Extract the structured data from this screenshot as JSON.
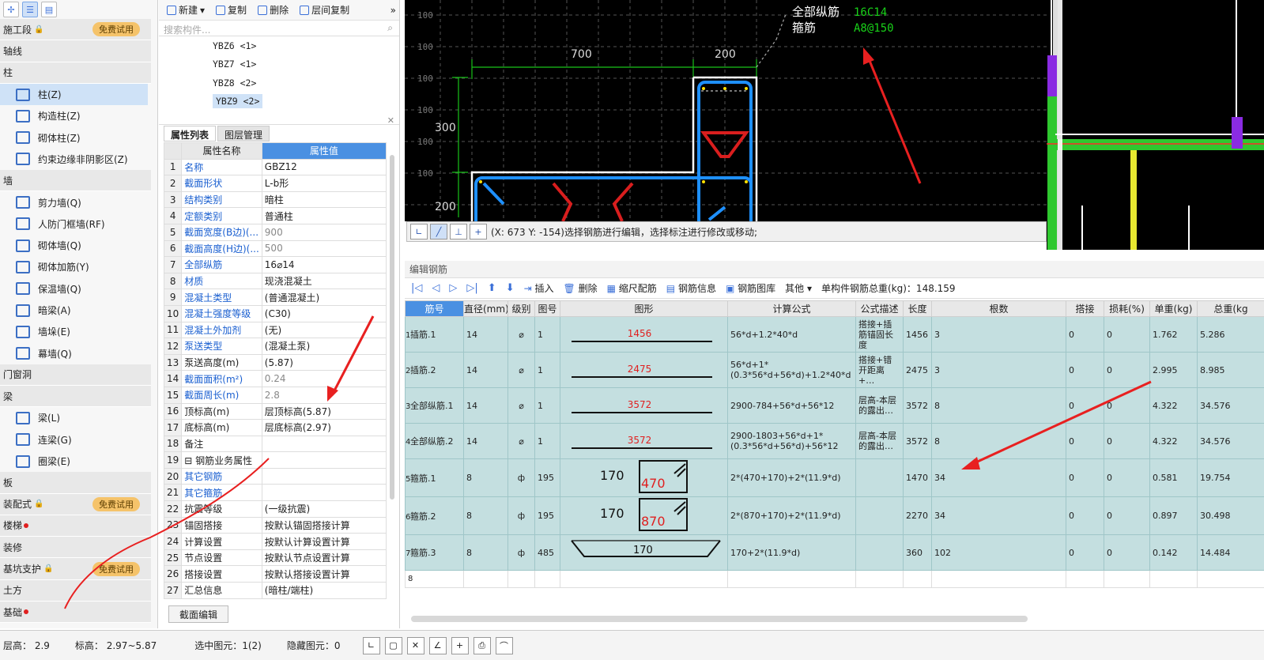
{
  "nav": {
    "rows": [
      {
        "type": "cat",
        "label": "施工段",
        "lock": true,
        "badge": "免费试用"
      },
      {
        "type": "cat",
        "label": "轴线"
      },
      {
        "type": "cat",
        "label": "柱"
      },
      {
        "type": "item",
        "label": "柱(Z)",
        "sel": true
      },
      {
        "type": "item",
        "label": "构造柱(Z)"
      },
      {
        "type": "item",
        "label": "砌体柱(Z)"
      },
      {
        "type": "item",
        "label": "约束边缘非阴影区(Z)"
      },
      {
        "type": "cat",
        "label": "墙"
      },
      {
        "type": "item",
        "label": "剪力墙(Q)"
      },
      {
        "type": "item",
        "label": "人防门框墙(RF)"
      },
      {
        "type": "item",
        "label": "砌体墙(Q)"
      },
      {
        "type": "item",
        "label": "砌体加筋(Y)"
      },
      {
        "type": "item",
        "label": "保温墙(Q)"
      },
      {
        "type": "item",
        "label": "暗梁(A)"
      },
      {
        "type": "item",
        "label": "墙垛(E)"
      },
      {
        "type": "item",
        "label": "幕墙(Q)"
      },
      {
        "type": "cat",
        "label": "门窗洞"
      },
      {
        "type": "cat",
        "label": "梁"
      },
      {
        "type": "item",
        "label": "梁(L)"
      },
      {
        "type": "item",
        "label": "连梁(G)"
      },
      {
        "type": "item",
        "label": "圈梁(E)"
      },
      {
        "type": "cat",
        "label": "板"
      },
      {
        "type": "cat",
        "label": "装配式",
        "lock": true,
        "badge": "免费试用"
      },
      {
        "type": "cat",
        "label": "楼梯",
        "dot": true
      },
      {
        "type": "cat",
        "label": "装修"
      },
      {
        "type": "cat",
        "label": "基坑支护",
        "lock": true,
        "badge": "免费试用"
      },
      {
        "type": "cat",
        "label": "土方"
      },
      {
        "type": "cat",
        "label": "基础",
        "dot": true
      }
    ]
  },
  "mid": {
    "toolbar": {
      "new": "新建",
      "copy": "复制",
      "delete": "删除",
      "floor_copy": "层间复制"
    },
    "search_placeholder": "搜索构件...",
    "components": [
      "YBZ6 <1>",
      "YBZ7 <1>",
      "YBZ8 <2>",
      "YBZ9 <2>"
    ],
    "tabs": [
      "属性列表",
      "图层管理"
    ],
    "prop_header": [
      "属性名称",
      "属性值"
    ],
    "props": [
      {
        "n": "1",
        "k": "名称",
        "v": "GBZ12",
        "kb": true
      },
      {
        "n": "2",
        "k": "截面形状",
        "v": "L-b形",
        "kb": true
      },
      {
        "n": "3",
        "k": "结构类别",
        "v": "暗柱",
        "kb": true
      },
      {
        "n": "4",
        "k": "定额类别",
        "v": "普通柱",
        "kb": true
      },
      {
        "n": "5",
        "k": "截面宽度(B边)(...",
        "v": "900",
        "kb": true,
        "vg": true
      },
      {
        "n": "6",
        "k": "截面高度(H边)(...",
        "v": "500",
        "kb": true,
        "vg": true
      },
      {
        "n": "7",
        "k": "全部纵筋",
        "v": "16⌀14",
        "kb": true
      },
      {
        "n": "8",
        "k": "材质",
        "v": "现浇混凝土",
        "kb": true
      },
      {
        "n": "9",
        "k": "混凝土类型",
        "v": "(普通混凝土)",
        "kb": true
      },
      {
        "n": "10",
        "k": "混凝土强度等级",
        "v": "(C30)",
        "kb": true
      },
      {
        "n": "11",
        "k": "混凝土外加剂",
        "v": "(无)",
        "kb": true
      },
      {
        "n": "12",
        "k": "泵送类型",
        "v": "(混凝土泵)",
        "kb": true
      },
      {
        "n": "13",
        "k": "泵送高度(m)",
        "v": "(5.87)"
      },
      {
        "n": "14",
        "k": "截面面积(m²)",
        "v": "0.24",
        "kb": true,
        "vg": true
      },
      {
        "n": "15",
        "k": "截面周长(m)",
        "v": "2.8",
        "kb": true,
        "vg": true
      },
      {
        "n": "16",
        "k": "顶标高(m)",
        "v": "层顶标高(5.87)"
      },
      {
        "n": "17",
        "k": "底标高(m)",
        "v": "层底标高(2.97)"
      },
      {
        "n": "18",
        "k": "备注",
        "v": ""
      },
      {
        "n": "19",
        "k": "⊟ 钢筋业务属性",
        "v": ""
      },
      {
        "n": "20",
        "k": "   其它钢筋",
        "v": "",
        "kb": true
      },
      {
        "n": "21",
        "k": "   其它箍筋",
        "v": "",
        "kb": true
      },
      {
        "n": "22",
        "k": "   抗震等级",
        "v": "(一级抗震)"
      },
      {
        "n": "23",
        "k": "   锚固搭接",
        "v": "按默认锚固搭接计算"
      },
      {
        "n": "24",
        "k": "   计算设置",
        "v": "按默认计算设置计算"
      },
      {
        "n": "25",
        "k": "   节点设置",
        "v": "按默认节点设置计算"
      },
      {
        "n": "26",
        "k": "   搭接设置",
        "v": "按默认搭接设置计算"
      },
      {
        "n": "27",
        "k": "   汇总信息",
        "v": "(暗柱/端柱)"
      }
    ],
    "edit_button": "截面编辑"
  },
  "cad": {
    "legend1": "全部纵筋",
    "legend1_val": "16C14",
    "legend2": "箍筋",
    "legend2_val": "A8@150",
    "dim_700": "700",
    "dim_200": "200",
    "dim_300": "300",
    "dim_200b": "200",
    "grid": "100",
    "status": "(X: 673 Y: -154)选择钢筋进行编辑，选择标注进行修改或移动;"
  },
  "rebar": {
    "title": "编辑钢筋",
    "toolbar": {
      "insert": "插入",
      "delete": "删除",
      "scale": "缩尺配筋",
      "info": "钢筋信息",
      "library": "钢筋图库",
      "other": "其他",
      "total": "单构件钢筋总重(kg)：148.159"
    },
    "headers": [
      "筋号",
      "直径(mm)",
      "级别",
      "图号",
      "图形",
      "计算公式",
      "公式描述",
      "长度",
      "根数",
      "搭接",
      "损耗(%)",
      "单重(kg)",
      "总重(kg"
    ],
    "rows": [
      {
        "rn": "1",
        "name": "插筋.1",
        "dia": "14",
        "grade": "⌀",
        "fig": "1",
        "shape": "line",
        "s1": "1456",
        "s2": "",
        "formula": "56*d+1.2*40*d",
        "desc": "搭接+插筋锚固长度",
        "len": "1456",
        "count": "3",
        "lap": "0",
        "loss": "0",
        "unit": "1.762",
        "total": "5.286"
      },
      {
        "rn": "2",
        "name": "插筋.2",
        "dia": "14",
        "grade": "⌀",
        "fig": "1",
        "shape": "line",
        "s1": "2475",
        "s2": "",
        "formula": "56*d+1*(0.3*56*d+56*d)+1.2*40*d",
        "desc": "搭接+错开距离+…",
        "len": "2475",
        "count": "3",
        "lap": "0",
        "loss": "0",
        "unit": "2.995",
        "total": "8.985"
      },
      {
        "rn": "3",
        "name": "全部纵筋.1",
        "dia": "14",
        "grade": "⌀",
        "fig": "1",
        "shape": "line",
        "s1": "3572",
        "s2": "",
        "formula": "2900-784+56*d+56*12",
        "desc": "层高-本层的露出…",
        "len": "3572",
        "count": "8",
        "lap": "0",
        "loss": "0",
        "unit": "4.322",
        "total": "34.576"
      },
      {
        "rn": "4",
        "name": "全部纵筋.2",
        "dia": "14",
        "grade": "⌀",
        "fig": "1",
        "shape": "line",
        "s1": "3572",
        "s2": "",
        "formula": "2900-1803+56*d+1*(0.3*56*d+56*d)+56*12",
        "desc": "层高-本层的露出…",
        "len": "3572",
        "count": "8",
        "lap": "0",
        "loss": "0",
        "unit": "4.322",
        "total": "34.576"
      },
      {
        "rn": "5",
        "name": "箍筋.1",
        "dia": "8",
        "grade": "ф",
        "fig": "195",
        "shape": "box",
        "s1": "170",
        "s2": "470",
        "formula": "2*(470+170)+2*(11.9*d)",
        "desc": "",
        "len": "1470",
        "count": "34",
        "lap": "0",
        "loss": "0",
        "unit": "0.581",
        "total": "19.754"
      },
      {
        "rn": "6",
        "name": "箍筋.2",
        "dia": "8",
        "grade": "ф",
        "fig": "195",
        "shape": "box",
        "s1": "170",
        "s2": "870",
        "formula": "2*(870+170)+2*(11.9*d)",
        "desc": "",
        "len": "2270",
        "count": "34",
        "lap": "0",
        "loss": "0",
        "unit": "0.897",
        "total": "30.498"
      },
      {
        "rn": "7",
        "name": "箍筋.3",
        "dia": "8",
        "grade": "ф",
        "fig": "485",
        "shape": "tie",
        "s1": "170",
        "s2": "",
        "formula": "170+2*(11.9*d)",
        "desc": "",
        "len": "360",
        "count": "102",
        "lap": "0",
        "loss": "0",
        "unit": "0.142",
        "total": "14.484"
      }
    ],
    "empty_rn": "8"
  },
  "status": {
    "floor": "层高： 2.9",
    "elev": "标高： 2.97~5.87",
    "selected": "选中图元：1(2)",
    "hidden": "隐藏图元：0"
  }
}
